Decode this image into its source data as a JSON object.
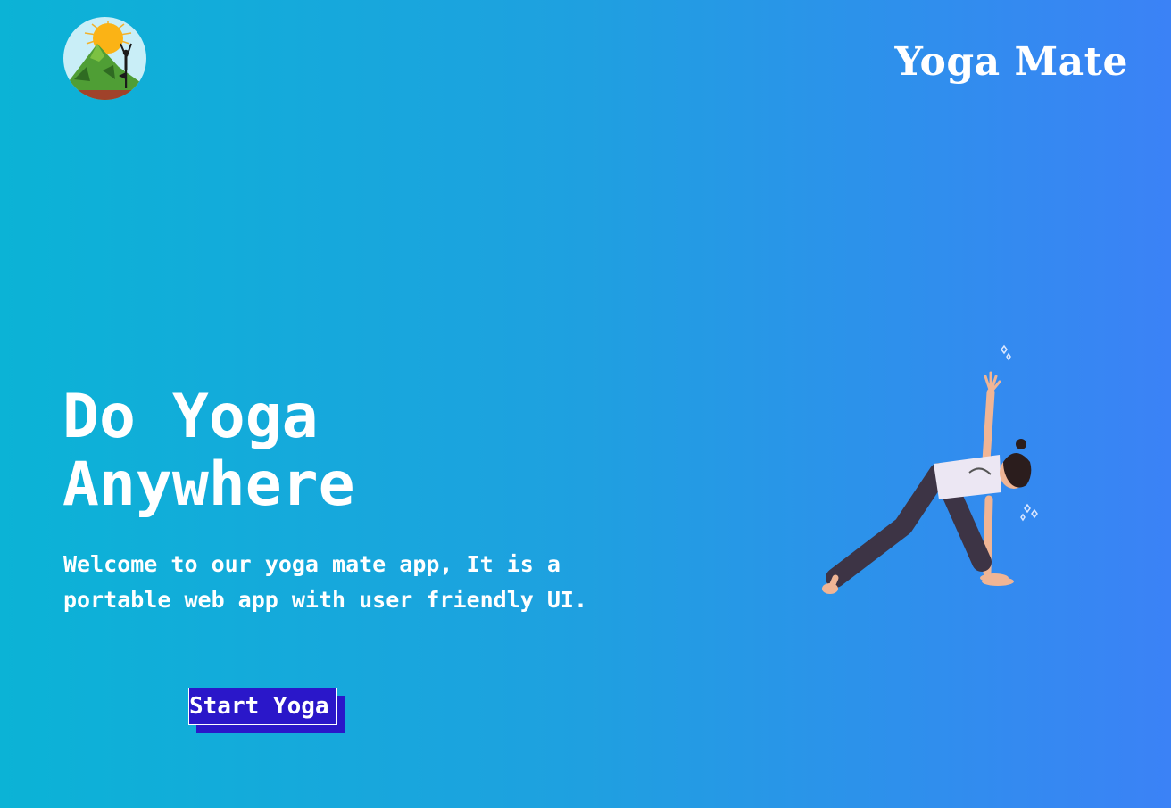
{
  "header": {
    "logo_icon": "yoga-mountain-sun-logo",
    "brand": "Yoga Mate"
  },
  "hero": {
    "title_line1": "Do Yoga",
    "title_line2": "Anywhere",
    "description": "Welcome to our yoga mate app, It is a portable web app with user friendly UI.",
    "cta_label": "Start Yoga",
    "illustration_icon": "yoga-triangle-pose-illustration"
  },
  "colors": {
    "gradient_start": "#0bb3d6",
    "gradient_end": "#3b82f6",
    "button_bg": "#2a17c9",
    "text": "#ffffff"
  }
}
